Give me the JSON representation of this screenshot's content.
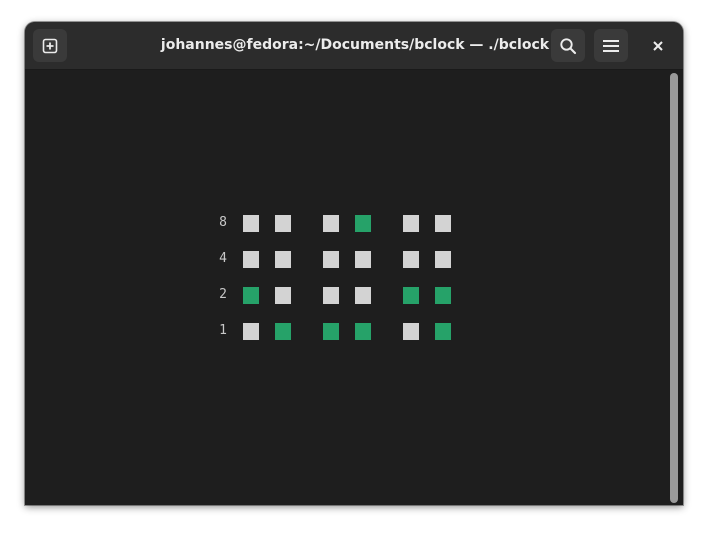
{
  "window": {
    "title": "johannes@fedora:~/Documents/bclock — ./bclock"
  },
  "headerbar": {
    "buttons": [
      {
        "name": "new-tab-button",
        "icon": "plus-box-icon"
      },
      {
        "name": "search-button",
        "icon": "search-icon"
      },
      {
        "name": "menu-button",
        "icon": "hamburger-menu-icon"
      },
      {
        "name": "close-button",
        "icon": "close-icon"
      }
    ]
  },
  "clock": {
    "row_labels": [
      "8",
      "4",
      "2",
      "1"
    ],
    "colors": {
      "on": "#26a269",
      "off": "#d3d3d3"
    },
    "columns": [
      {
        "bits": [
          false,
          false,
          true,
          false
        ]
      },
      {
        "bits": [
          false,
          false,
          false,
          true
        ]
      },
      {
        "bits": [
          false,
          false,
          false,
          true
        ]
      },
      {
        "bits": [
          true,
          false,
          false,
          true
        ]
      },
      {
        "bits": [
          false,
          false,
          true,
          false
        ]
      },
      {
        "bits": [
          false,
          false,
          true,
          true
        ]
      }
    ]
  }
}
